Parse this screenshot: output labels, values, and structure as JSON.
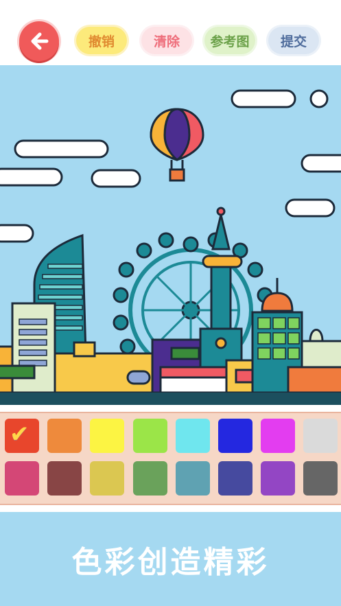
{
  "toolbar": {
    "back_icon": "arrow-left-icon",
    "undo_label": "撤销",
    "clear_label": "清除",
    "reference_label": "参考图",
    "submit_label": "提交"
  },
  "palette": {
    "selected_index": 0,
    "colors": [
      "#e8462c",
      "#ee8a3c",
      "#fcf443",
      "#9be548",
      "#6fe6ee",
      "#2428e0",
      "#e33df0",
      "#dadada",
      "#d44776",
      "#884545",
      "#dbc751",
      "#6aa25b",
      "#5fa2b2",
      "#464a9f",
      "#9346c4",
      "#666666"
    ],
    "selected_icon": "checkmark-icon"
  },
  "footer": {
    "slogan": "色彩创造精彩"
  }
}
